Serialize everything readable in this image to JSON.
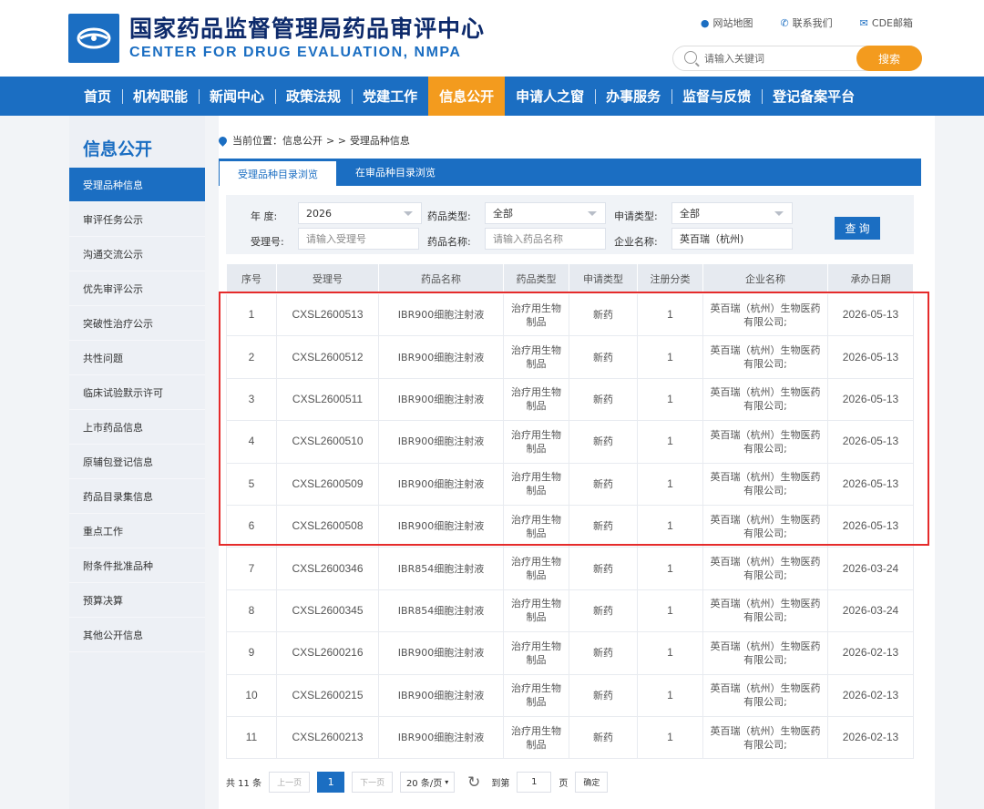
{
  "header": {
    "title": "国家药品监督管理局药品审评中心",
    "subtitle": "CENTER FOR DRUG EVALUATION, NMPA",
    "links": [
      "网站地图",
      "联系我们",
      "CDE邮箱"
    ],
    "search_placeholder": "请输入关键词",
    "search_button": "搜索"
  },
  "nav": [
    "首页",
    "机构职能",
    "新闻中心",
    "政策法规",
    "党建工作",
    "信息公开",
    "申请人之窗",
    "办事服务",
    "监督与反馈",
    "登记备案平台"
  ],
  "nav_active": "信息公开",
  "sidebar": {
    "title": "信息公开",
    "items": [
      "受理品种信息",
      "审评任务公示",
      "沟通交流公示",
      "优先审评公示",
      "突破性治疗公示",
      "共性问题",
      "临床试验默示许可",
      "上市药品信息",
      "原辅包登记信息",
      "药品目录集信息",
      "重点工作",
      "附条件批准品种",
      "预算决算",
      "其他公开信息"
    ]
  },
  "breadcrumb": {
    "prefix": "当前位置：信息公开",
    "sep": "> >",
    "current": "受理品种信息"
  },
  "tabs": [
    "受理品种目录浏览",
    "在审品种目录浏览"
  ],
  "filters": {
    "year_label": "年  度:",
    "year_value": "2026",
    "drug_type_label": "药品类型:",
    "drug_type_value": "全部",
    "apply_type_label": "申请类型:",
    "apply_type_value": "全部",
    "accept_no_label": "受理号:",
    "accept_no_placeholder": "请输入受理号",
    "drug_name_label": "药品名称:",
    "drug_name_placeholder": "请输入药品名称",
    "company_label": "企业名称:",
    "company_value": "英百瑞（杭州)",
    "query_button": "查 询"
  },
  "table": {
    "headers": [
      "序号",
      "受理号",
      "药品名称",
      "药品类型",
      "申请类型",
      "注册分类",
      "企业名称",
      "承办日期"
    ],
    "rows": [
      [
        "1",
        "CXSL2600513",
        "IBR900细胞注射液",
        "治疗用生物制品",
        "新药",
        "1",
        "英百瑞（杭州）生物医药有限公司;",
        "2026-05-13"
      ],
      [
        "2",
        "CXSL2600512",
        "IBR900细胞注射液",
        "治疗用生物制品",
        "新药",
        "1",
        "英百瑞（杭州）生物医药有限公司;",
        "2026-05-13"
      ],
      [
        "3",
        "CXSL2600511",
        "IBR900细胞注射液",
        "治疗用生物制品",
        "新药",
        "1",
        "英百瑞（杭州）生物医药有限公司;",
        "2026-05-13"
      ],
      [
        "4",
        "CXSL2600510",
        "IBR900细胞注射液",
        "治疗用生物制品",
        "新药",
        "1",
        "英百瑞（杭州）生物医药有限公司;",
        "2026-05-13"
      ],
      [
        "5",
        "CXSL2600509",
        "IBR900细胞注射液",
        "治疗用生物制品",
        "新药",
        "1",
        "英百瑞（杭州）生物医药有限公司;",
        "2026-05-13"
      ],
      [
        "6",
        "CXSL2600508",
        "IBR900细胞注射液",
        "治疗用生物制品",
        "新药",
        "1",
        "英百瑞（杭州）生物医药有限公司;",
        "2026-05-13"
      ],
      [
        "7",
        "CXSL2600346",
        "IBR854细胞注射液",
        "治疗用生物制品",
        "新药",
        "1",
        "英百瑞（杭州）生物医药有限公司;",
        "2026-03-24"
      ],
      [
        "8",
        "CXSL2600345",
        "IBR854细胞注射液",
        "治疗用生物制品",
        "新药",
        "1",
        "英百瑞（杭州）生物医药有限公司;",
        "2026-03-24"
      ],
      [
        "9",
        "CXSL2600216",
        "IBR900细胞注射液",
        "治疗用生物制品",
        "新药",
        "1",
        "英百瑞（杭州）生物医药有限公司;",
        "2026-02-13"
      ],
      [
        "10",
        "CXSL2600215",
        "IBR900细胞注射液",
        "治疗用生物制品",
        "新药",
        "1",
        "英百瑞（杭州）生物医药有限公司;",
        "2026-02-13"
      ],
      [
        "11",
        "CXSL2600213",
        "IBR900细胞注射液",
        "治疗用生物制品",
        "新药",
        "1",
        "英百瑞（杭州）生物医药有限公司;",
        "2026-02-13"
      ]
    ]
  },
  "pager": {
    "total": "共 11 条",
    "prev": "上一页",
    "current": "1",
    "next": "下一页",
    "page_size": "20 条/页",
    "goto": "到第",
    "goto_value": "1",
    "page_unit": "页",
    "confirm": "确定"
  },
  "colors": {
    "primary": "#1b6ec2",
    "accent": "#f39b1e",
    "highlight": "#e52b2b"
  }
}
